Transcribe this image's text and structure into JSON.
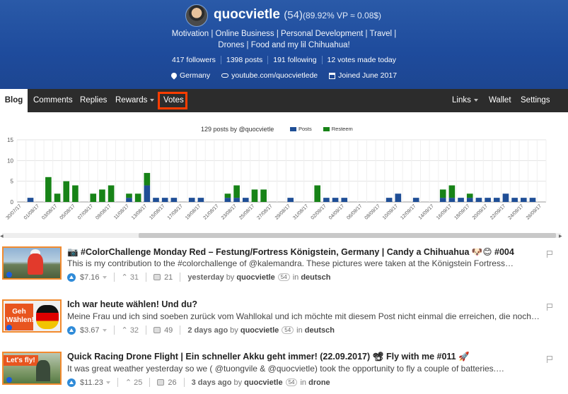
{
  "profile": {
    "name": "quocvietle",
    "reputation": "(54)",
    "vp": "(89.92% VP ≈ 0.08$)",
    "about_line1": "Motivation | Online Business | Personal Development | Travel |",
    "about_line2": "Drones | Food and my lil Chihuahua!",
    "stats": [
      "417 followers",
      "1398 posts",
      "191 following",
      "12 votes made today"
    ],
    "location": "Germany",
    "website": "youtube.com/quocvietlede",
    "joined": "Joined June 2017"
  },
  "nav": {
    "left": [
      "Blog",
      "Comments",
      "Replies",
      "Rewards",
      "Votes"
    ],
    "right": [
      "Links",
      "Wallet",
      "Settings"
    ]
  },
  "chart_data": {
    "type": "bar",
    "title": "129 posts by @quocvietle",
    "legend": [
      "Posts",
      "Resteem"
    ],
    "colors": {
      "posts": "#1f4e96",
      "resteem": "#178317"
    },
    "ylim": [
      0,
      15
    ],
    "yticks": [
      "15",
      "10",
      "5",
      "0"
    ],
    "x": [
      "30/07/17",
      "31/07/17",
      "01/08/17",
      "02/08/17",
      "03/08/17",
      "04/08/17",
      "05/08/17",
      "06/08/17",
      "07/08/17",
      "08/08/17",
      "09/08/17",
      "10/08/17",
      "11/08/17",
      "12/08/17",
      "13/08/17",
      "14/08/17",
      "15/08/17",
      "16/08/17",
      "17/08/17",
      "18/08/17",
      "19/08/17",
      "20/08/17",
      "21/08/17",
      "22/08/17",
      "23/08/17",
      "24/08/17",
      "25/08/17",
      "26/08/17",
      "27/08/17",
      "28/08/17",
      "29/08/17",
      "30/08/17",
      "31/08/17",
      "01/09/17",
      "02/09/17",
      "03/09/17",
      "04/09/17",
      "05/09/17",
      "06/09/17",
      "07/09/17",
      "08/09/17",
      "09/09/17",
      "10/09/17",
      "11/09/17",
      "12/09/17",
      "13/09/17",
      "14/09/17",
      "15/09/17",
      "16/09/17",
      "17/09/17",
      "18/09/17",
      "19/09/17",
      "20/09/17",
      "21/09/17",
      "22/09/17",
      "23/09/17",
      "24/09/17",
      "25/09/17",
      "26/09/17"
    ],
    "xlabels": [
      "30/07/17",
      "01/08/17",
      "03/08/17",
      "05/08/17",
      "07/08/17",
      "09/08/17",
      "11/08/17",
      "13/08/17",
      "15/08/17",
      "17/08/17",
      "19/08/17",
      "21/08/17",
      "23/08/17",
      "25/08/17",
      "27/08/17",
      "29/08/17",
      "31/08/17",
      "02/09/17",
      "04/09/17",
      "06/09/17",
      "08/09/17",
      "10/09/17",
      "12/09/17",
      "14/09/17",
      "16/09/17",
      "18/09/17",
      "20/09/17",
      "22/09/17",
      "24/09/17",
      "26/09/17"
    ],
    "series": [
      {
        "name": "Posts",
        "values": [
          0,
          1,
          0,
          0,
          0,
          0,
          0,
          0,
          0,
          0,
          0,
          0,
          1,
          0,
          4,
          1,
          1,
          1,
          0,
          1,
          1,
          0,
          0,
          1,
          1,
          1,
          0,
          0,
          0,
          0,
          1,
          0,
          0,
          0,
          1,
          1,
          1,
          0,
          0,
          0,
          0,
          1,
          2,
          0,
          1,
          0,
          0,
          1,
          1,
          1,
          1,
          1,
          1,
          1,
          2,
          1,
          1,
          1,
          0
        ]
      },
      {
        "name": "Resteem",
        "values": [
          0,
          0,
          0,
          6,
          2,
          5,
          4,
          0,
          2,
          3,
          4,
          0,
          1,
          2,
          3,
          0,
          0,
          0,
          0,
          0,
          0,
          0,
          0,
          1,
          3,
          0,
          3,
          3,
          0,
          0,
          0,
          0,
          0,
          4,
          0,
          0,
          0,
          0,
          0,
          0,
          0,
          0,
          0,
          0,
          0,
          0,
          0,
          2,
          3,
          0,
          1,
          0,
          0,
          0,
          0,
          0,
          0,
          0,
          0
        ]
      }
    ]
  },
  "posts": [
    {
      "title": "📷 #ColorChallenge Monday Red – Festung/Fortress Königstein, Germany | Candy a Chihuahua 🐶😊 #004",
      "desc": "This is my contribution to the #colorchallenge of @kalemandra. These pictures were taken at the Königstein Fortress…",
      "payout": "$7.16",
      "votes": "31",
      "comments": "21",
      "time": "yesterday",
      "by": "by",
      "author": "quocvietle",
      "rep": "54",
      "in": "in",
      "category": "deutsch"
    },
    {
      "title": "Ich war heute wählen! Und du?",
      "desc": "Meine Frau und ich sind soeben zurück vom Wahllokal und ich möchte mit diesem Post nicht einmal die erreichen, die noch…",
      "payout": "$3.67",
      "votes": "32",
      "comments": "49",
      "time": "2 days ago",
      "by": "by",
      "author": "quocvietle",
      "rep": "54",
      "in": "in",
      "category": "deutsch",
      "thumb_label": "Geh Wählen!"
    },
    {
      "title": "Quick Racing Drone Flight | Ein schneller Akku geht immer! (22.09.2017) 📽 Fly with me #011 🚀",
      "desc": "It was great weather yesterday so we ( @tuongvile & @quocvietle) took the opportunity to fly a couple of batteries.…",
      "payout": "$11.23",
      "votes": "25",
      "comments": "26",
      "time": "3 days ago",
      "by": "by",
      "author": "quocvietle",
      "rep": "54",
      "in": "in",
      "category": "drone",
      "thumb_label": "Let's fly!"
    }
  ]
}
